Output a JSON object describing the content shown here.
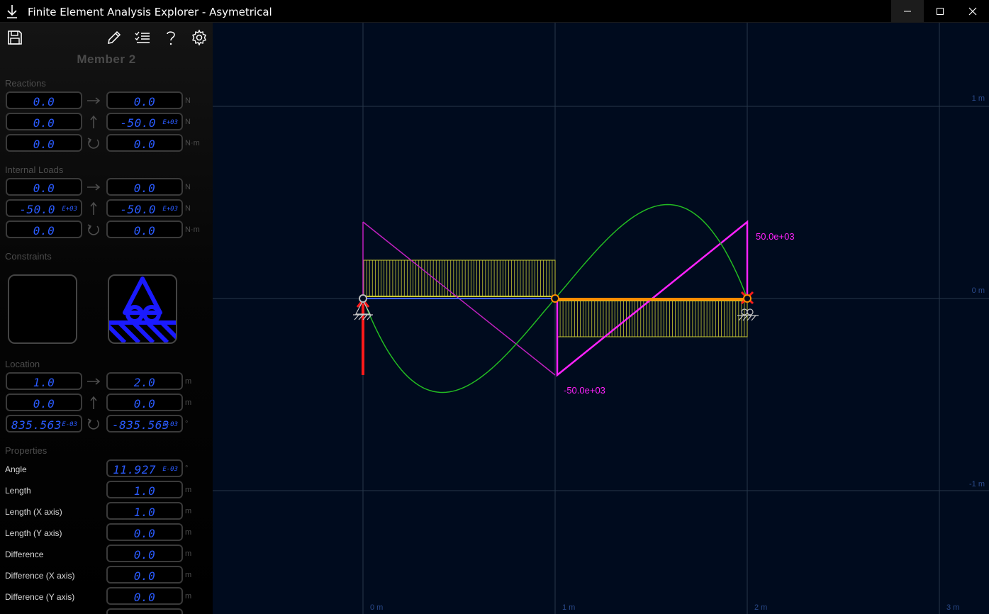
{
  "window": {
    "title": "Finite Element Analysis Explorer - Asymetrical",
    "app_icon": "download-arrow-icon",
    "controls": [
      "minimize-icon",
      "maximize-icon",
      "close-icon"
    ]
  },
  "toolbar": {
    "icons": [
      "save-icon",
      "edit-pencil-icon",
      "checklist-icon",
      "help-icon",
      "settings-gear-icon"
    ]
  },
  "member": {
    "title": "Member 2"
  },
  "reactions": {
    "label": "Reactions",
    "rows": [
      {
        "left": "0.0",
        "right": "0.0",
        "arrow": "arrow-right-icon",
        "unit": "N"
      },
      {
        "left": "0.0",
        "right": "-50.0",
        "right_exp": "E+03",
        "arrow": "arrow-up-icon",
        "unit": "N"
      },
      {
        "left": "0.0",
        "right": "0.0",
        "arrow": "rotate-ccw-icon",
        "unit": "N·m"
      }
    ]
  },
  "internal_loads": {
    "label": "Internal Loads",
    "rows": [
      {
        "left": "0.0",
        "right": "0.0",
        "arrow": "arrow-right-icon",
        "unit": "N"
      },
      {
        "left": "-50.0",
        "left_exp": "E+03",
        "right": "-50.0",
        "right_exp": "E+03",
        "arrow": "arrow-up-icon",
        "unit": "N"
      },
      {
        "left": "0.0",
        "right": "0.0",
        "arrow": "rotate-ccw-icon",
        "unit": "N·m"
      }
    ]
  },
  "constraints": {
    "label": "Constraints",
    "left": "none",
    "right": "roller-support-icon"
  },
  "location": {
    "label": "Location",
    "rows": [
      {
        "left": "1.0",
        "right": "2.0",
        "arrow": "arrow-right-icon",
        "unit": "m"
      },
      {
        "left": "0.0",
        "right": "0.0",
        "arrow": "arrow-up-icon",
        "unit": "m"
      },
      {
        "left": "835.563",
        "left_exp": "E-03",
        "right": "-835.563",
        "right_exp": "E-03",
        "arrow": "rotate-ccw-icon",
        "unit": "°"
      }
    ]
  },
  "properties": {
    "label": "Properties",
    "rows": [
      {
        "label": "Angle",
        "value": "11.927",
        "exp": "E-03",
        "unit": "°"
      },
      {
        "label": "Length",
        "value": "1.0",
        "unit": "m"
      },
      {
        "label": "Length (X axis)",
        "value": "1.0",
        "unit": "m"
      },
      {
        "label": "Length (Y axis)",
        "value": "0.0",
        "unit": "m"
      },
      {
        "label": "Difference",
        "value": "0.0",
        "unit": "m"
      },
      {
        "label": "Difference (X axis)",
        "value": "0.0",
        "unit": "m"
      },
      {
        "label": "Difference (Y axis)",
        "value": "0.0",
        "unit": "m"
      }
    ]
  },
  "canvas": {
    "x_ticks": [
      "0 m",
      "1 m",
      "2 m",
      "3 m"
    ],
    "y_ticks": [
      "1 m",
      "0 m",
      "-1 m"
    ],
    "moment_max_label": "50.0e+03",
    "moment_min_label": "-50.0e+03",
    "colors": {
      "background": "#000b1e",
      "grid": "#27374a",
      "deflection": "#22bb22",
      "shear_moment": "#ff22ff",
      "distributed_load": "#c8c832",
      "reaction": "#ff1a1a",
      "member": "#ff8c00"
    }
  }
}
